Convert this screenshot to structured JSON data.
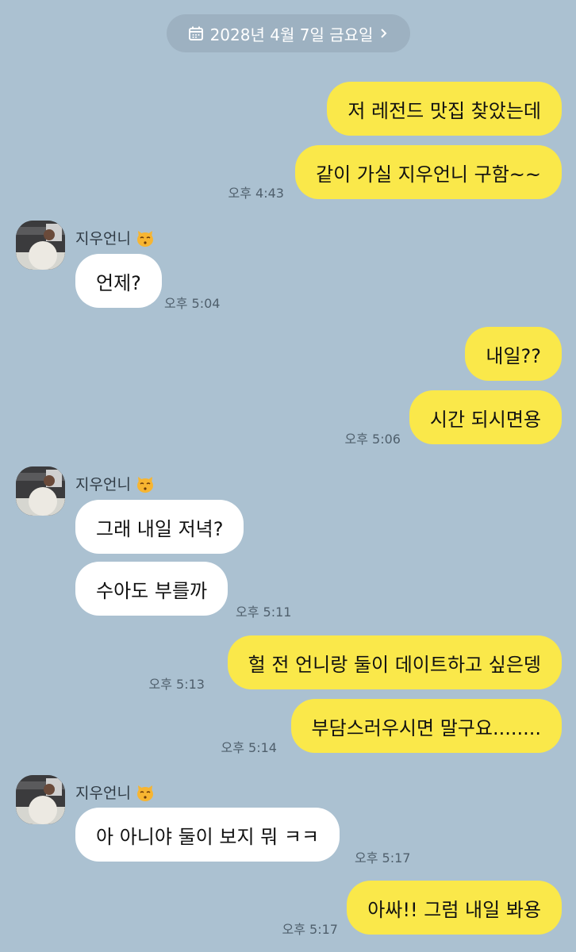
{
  "date_divider": {
    "label": "2028년 4월 7일 금요일",
    "icon": "calendar-icon",
    "chevron": "chevron-right-icon"
  },
  "colors": {
    "background": "#abc1d1",
    "my_bubble": "#fae84a",
    "their_bubble": "#ffffff"
  },
  "messages": [
    {
      "from": "me",
      "text": "저 레전드 맛집 찾았는데"
    },
    {
      "from": "me",
      "text": "같이 가실 지우언니 구함~~",
      "time": "오후 4:43"
    },
    {
      "from": "them",
      "sender": "지우언니",
      "text": "언제?",
      "time": "오후 5:04"
    },
    {
      "from": "me",
      "text": "내일??"
    },
    {
      "from": "me",
      "text": "시간 되시면용",
      "time": "오후 5:06"
    },
    {
      "from": "them",
      "sender": "지우언니",
      "text": "그래 내일 저녁?"
    },
    {
      "from": "them",
      "text": "수아도 부를까",
      "time": "오후 5:11"
    },
    {
      "from": "me",
      "text": "헐 전 언니랑 둘이 데이트하고 싶은뎅",
      "time": "오후 5:13"
    },
    {
      "from": "me",
      "text": "부담스러우시면 말구요........",
      "time": "오후 5:14"
    },
    {
      "from": "them",
      "sender": "지우언니",
      "text": "아 아니야 둘이 보지 뭐 ㅋㅋ",
      "time": "오후 5:17"
    },
    {
      "from": "me",
      "text": "아싸!! 그럼 내일 봐용",
      "time": "오후 5:17"
    }
  ]
}
